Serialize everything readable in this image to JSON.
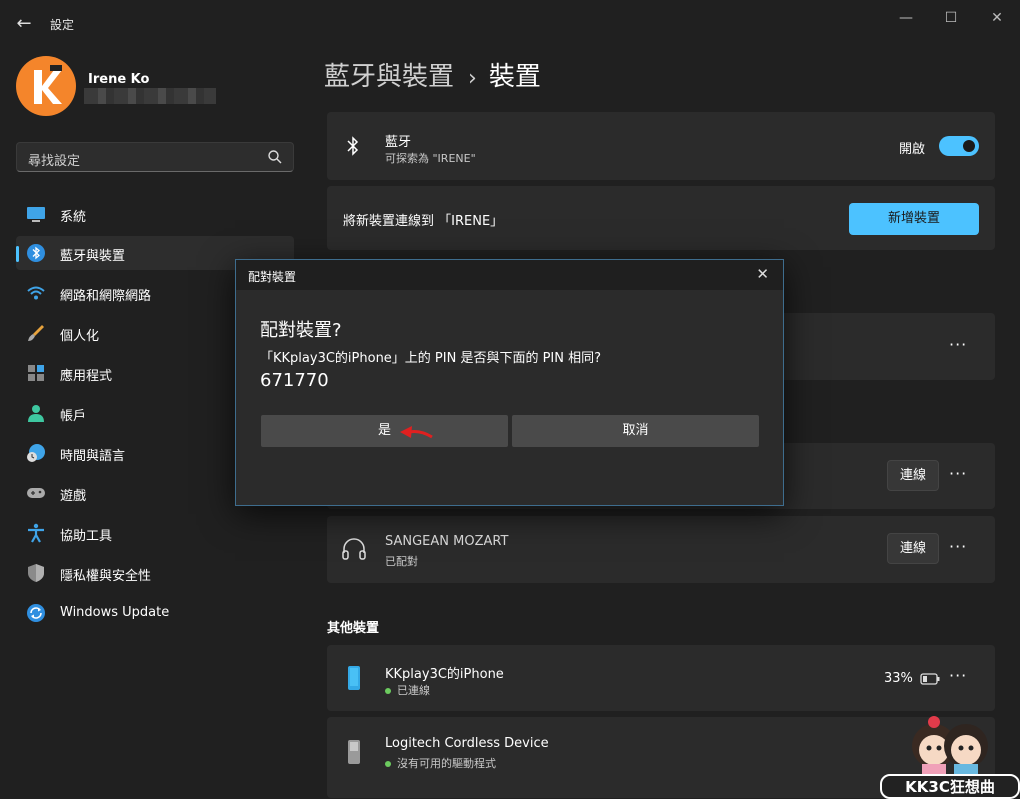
{
  "window": {
    "title": "設定",
    "back": "←",
    "minimize": "—",
    "maximize": "☐",
    "close": "✕"
  },
  "user": {
    "name": "Irene Ko"
  },
  "search": {
    "placeholder": "尋找設定"
  },
  "nav": [
    {
      "label": "系統",
      "icon": "monitor-icon"
    },
    {
      "label": "藍牙與裝置",
      "icon": "bluetooth-icon",
      "active": true
    },
    {
      "label": "網路和網際網路",
      "icon": "wifi-icon"
    },
    {
      "label": "個人化",
      "icon": "brush-icon"
    },
    {
      "label": "應用程式",
      "icon": "apps-icon"
    },
    {
      "label": "帳戶",
      "icon": "person-icon"
    },
    {
      "label": "時間與語言",
      "icon": "globe-clock-icon"
    },
    {
      "label": "遊戲",
      "icon": "gamepad-icon"
    },
    {
      "label": "協助工具",
      "icon": "accessibility-icon"
    },
    {
      "label": "隱私權與安全性",
      "icon": "shield-icon"
    },
    {
      "label": "Windows Update",
      "icon": "update-icon"
    }
  ],
  "breadcrumb": {
    "parent": "藍牙與裝置",
    "sep": "›",
    "current": "裝置"
  },
  "bluetooth_card": {
    "title": "藍牙",
    "subtitle": "可探索為 \"IRENE\"",
    "toggle_label": "開啟",
    "toggle_on": true
  },
  "add_card": {
    "text": "將新裝置連線到 「IRENE」",
    "button": "新增裝置"
  },
  "devices": {
    "more": "···",
    "connect_label": "連線",
    "sangean": {
      "name": "SANGEAN MOZART",
      "status": "已配對"
    },
    "other_heading": "其他裝置",
    "iphone": {
      "name": "KKplay3C的iPhone",
      "status": "已連線",
      "battery": "33%"
    },
    "logitech": {
      "name": "Logitech Cordless Device",
      "status": "沒有可用的驅動程式"
    }
  },
  "dialog": {
    "window_title": "配對裝置",
    "close": "✕",
    "heading": "配對裝置?",
    "message": "「KKplay3C的iPhone」上的 PIN 是否與下面的 PIN 相同?",
    "pin": "671770",
    "yes": "是",
    "cancel": "取消"
  },
  "watermark": {
    "text": "KK3C狂想曲"
  },
  "colors": {
    "accent": "#4cc2ff",
    "background": "#202020",
    "card": "#2b2b2b",
    "status_green": "#6ccb5f",
    "arrow": "#e02020"
  }
}
